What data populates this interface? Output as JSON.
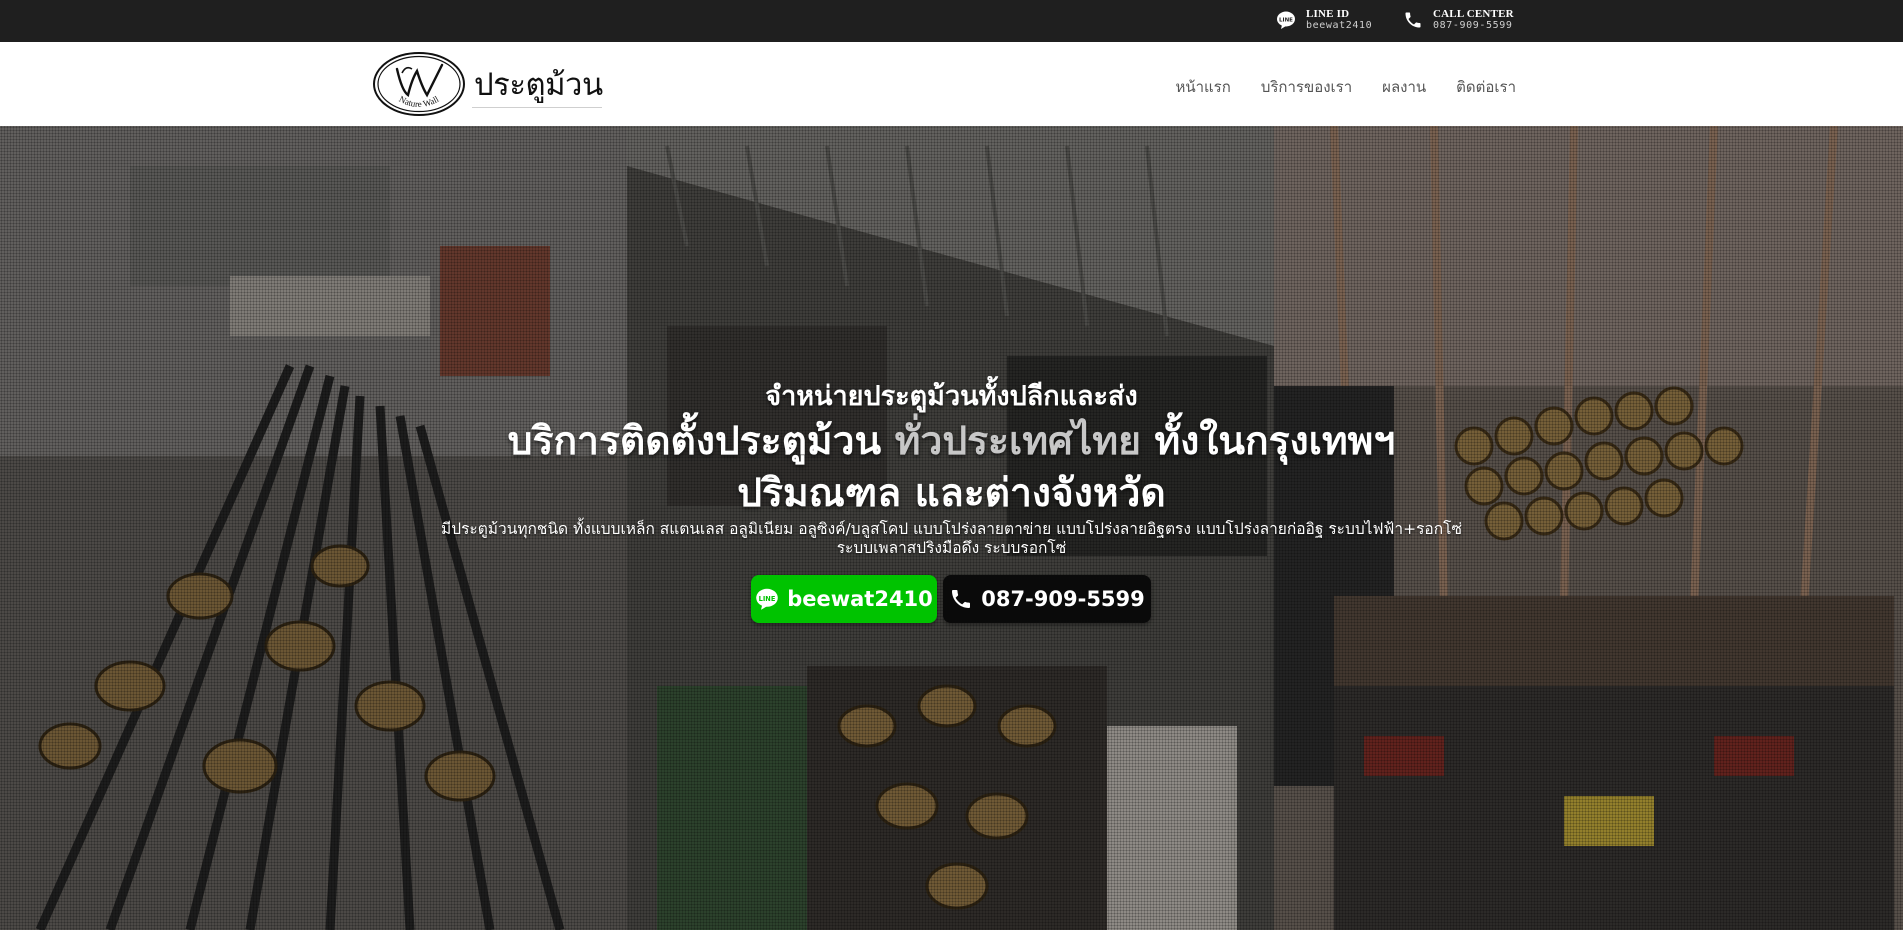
{
  "colors": {
    "topbar": "#1f1f1f",
    "line_green": "#00c300",
    "call_black": "#0a0a0a",
    "highlight_gray": "#c7c7c7"
  },
  "topbar": {
    "line": {
      "icon": "line-icon",
      "label": "LINE ID",
      "value": "beewat2410"
    },
    "call": {
      "icon": "phone-icon",
      "label": "CALL CENTER",
      "value": "087-909-5599"
    }
  },
  "header": {
    "logo_emblem_text": "Nature Wall",
    "logo_text": "ประตูม้วน",
    "nav": [
      "หน้าแรก",
      "บริการของเรา",
      "ผลงาน",
      "ติดต่อเรา"
    ]
  },
  "hero": {
    "subtitle": "จำหน่ายประตูม้วนทั้งปลีกและส่ง",
    "title_part1": "บริการติดตั้งประตูม้วน ",
    "title_highlight": "ทั่วประเทศไทย",
    "title_part2": " ทั้งในกรุงเทพฯ",
    "title_line2": "ปริมณฑล และต่างจังหวัด",
    "description": "มีประตูม้วนทุกชนิด ทั้งแบบเหล็ก สแตนเลส อลูมิเนียม อลูซิงค์/บลูสโคป แบบโปร่งลายตาข่าย แบบโปร่งลายอิฐตรง แบบโปร่งลายก่ออิฐ ระบบไฟฟ้า+รอกโซ่ ระบบเพลาสปริงมือดึง ระบบรอกโซ่",
    "line_button": {
      "icon": "line-icon",
      "label": "beewat2410"
    },
    "call_button": {
      "icon": "phone-icon",
      "label": "087-909-5599"
    }
  }
}
